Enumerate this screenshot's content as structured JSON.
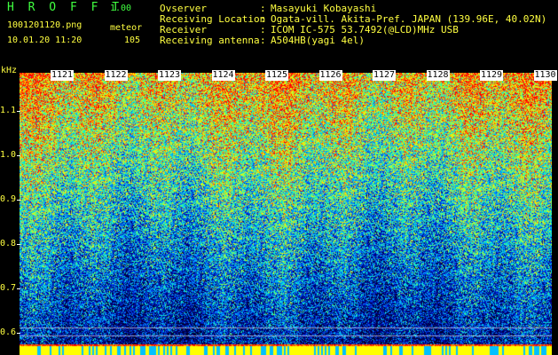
{
  "app": {
    "title": "H R O F F T",
    "version": "1.00"
  },
  "file": {
    "name": "1001201120.png",
    "datetime": "10.01.20 11:20"
  },
  "detection": {
    "mode": "meteor",
    "count": "105"
  },
  "info": [
    {
      "key": "Ovserver",
      "value": "Masayuki Kobayashi"
    },
    {
      "key": "Receiving Location",
      "value": "Ogata-vill. Akita-Pref. JAPAN (139.96E, 40.02N)"
    },
    {
      "key": "Receiver",
      "value": "ICOM IC-575 53.7492(@LCD)MHz USB"
    },
    {
      "key": "Receiving antenna",
      "value": "A504HB(yagi 4el)"
    }
  ],
  "axis": {
    "unit": "kHz",
    "ticks": [
      "1.1",
      "1.0",
      "0.9",
      "0.8",
      "0.7",
      "0.6"
    ],
    "minute_labels": [
      "1121",
      "1122",
      "1123",
      "1124",
      "1125",
      "1126",
      "1127",
      "1128",
      "1129",
      "1130"
    ]
  },
  "colors": {
    "label": "#ffff40",
    "title": "#40ff40"
  }
}
